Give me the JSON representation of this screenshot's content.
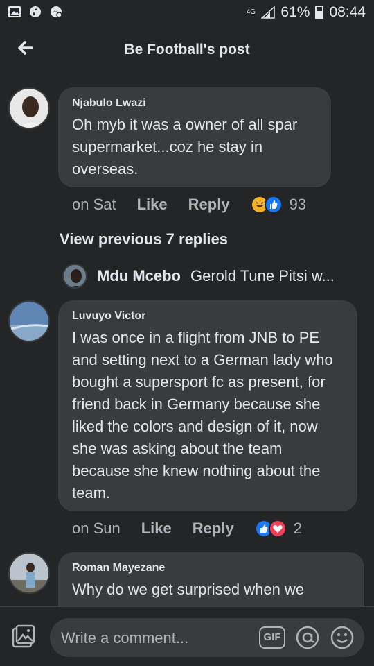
{
  "status_bar": {
    "network": "4G",
    "battery": "61%",
    "time": "08:44"
  },
  "header": {
    "title": "Be Football's post"
  },
  "comments": [
    {
      "name": "Njabulo Lwazi",
      "text": "Oh myb it was a owner of all spar supermarket...coz he stay in overseas.",
      "time": "on Sat",
      "like": "Like",
      "reply": "Reply",
      "reactions": [
        "haha",
        "like"
      ],
      "reaction_count": "93"
    },
    {
      "name": "Luvuyo Victor",
      "text": "I was once in a flight from JNB to PE and setting next to a German lady who bought a supersport fc as present, for friend back in Germany because she liked the colors and design of it, now she was asking about the team because she knew nothing about the team.",
      "time": "on Sun",
      "like": "Like",
      "reply": "Reply",
      "reactions": [
        "like",
        "love"
      ],
      "reaction_count": "2"
    },
    {
      "name": "Roman Mayezane",
      "text": "Why do we get surprised when we"
    }
  ],
  "view_previous": "View previous 7 replies",
  "reply_preview": {
    "name": "Mdu Mcebo",
    "text": "Gerold Tune Pitsi w..."
  },
  "composer": {
    "placeholder": "Write a comment...",
    "gif_label": "GIF"
  },
  "colors": {
    "background": "#242526",
    "bubble": "#3a3b3c",
    "like_blue": "#1877f2",
    "love_red": "#f33e58",
    "haha_yellow": "#f7b125"
  }
}
